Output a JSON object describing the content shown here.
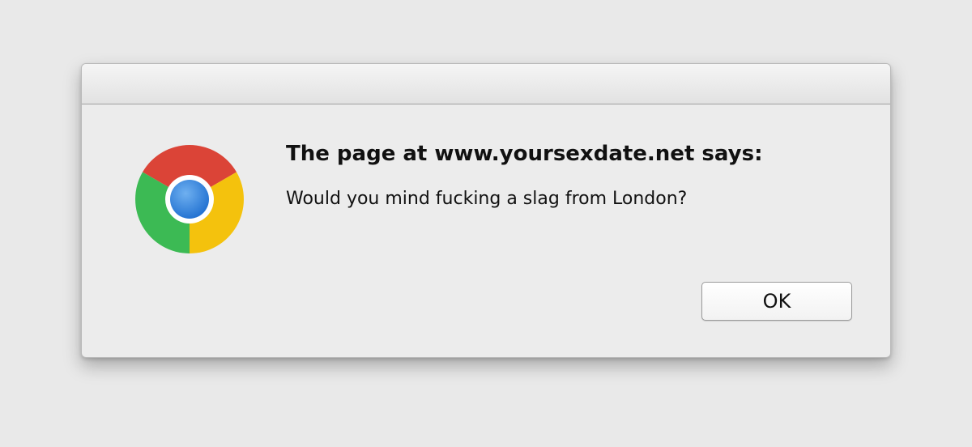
{
  "dialog": {
    "heading": "The page at www.yoursexdate.net says:",
    "message": "Would you mind fucking a slag from London?",
    "ok_label": "OK",
    "icon": "chrome-logo-icon"
  },
  "colors": {
    "background": "#e9e9e9",
    "dialog_bg": "#ececec",
    "chrome_red": "#db4437",
    "chrome_yellow": "#f4c20d",
    "chrome_green": "#3cba54",
    "chrome_blue": "#4285f4"
  }
}
